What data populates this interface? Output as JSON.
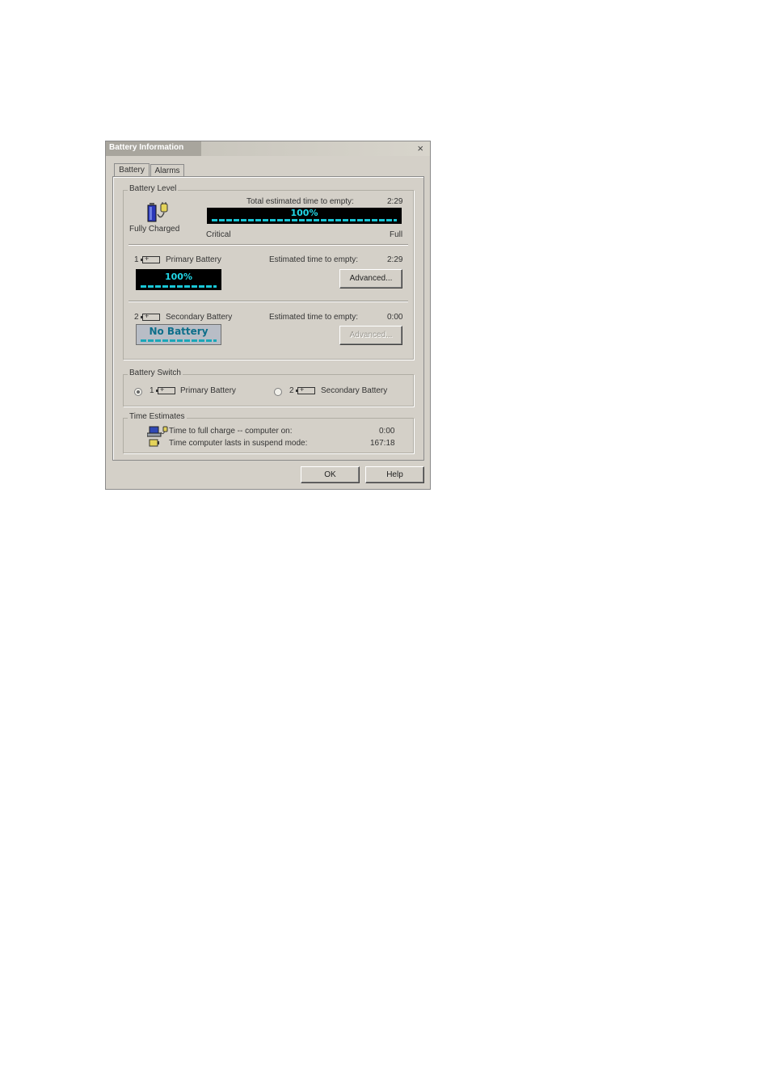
{
  "window": {
    "title": "Battery Information",
    "close": "×"
  },
  "tabs": [
    {
      "label": "Battery"
    },
    {
      "label": "Alarms"
    }
  ],
  "battery_level": {
    "legend": "Battery Level",
    "status": "Fully Charged",
    "total_label": "Total estimated time to empty:",
    "total_value": "2:29",
    "percent_text": "100%",
    "percent_value": 100,
    "min_label": "Critical",
    "max_label": "Full"
  },
  "primary": {
    "number": "1",
    "label": "Primary Battery",
    "time_label": "Estimated time to empty:",
    "time_value": "2:29",
    "percent_text": "100%",
    "percent_value": 100,
    "advanced_label": "Advanced..."
  },
  "secondary": {
    "number": "2",
    "label": "Secondary Battery",
    "time_label": "Estimated time to empty:",
    "time_value": "0:00",
    "status_text": "No Battery",
    "advanced_label": "Advanced..."
  },
  "switch": {
    "legend": "Battery Switch",
    "primary_number": "1",
    "primary_label": "Primary Battery",
    "secondary_number": "2",
    "secondary_label": "Secondary Battery",
    "selected": "primary"
  },
  "estimates": {
    "legend": "Time Estimates",
    "full_charge_label": "Time to full charge -- computer on:",
    "full_charge_value": "0:00",
    "suspend_label": "Time computer lasts in suspend mode:",
    "suspend_value": "167:18"
  },
  "buttons": {
    "ok": "OK",
    "help": "Help"
  },
  "colors": {
    "lcd_bg": "#000000",
    "lcd_text": "#22d8e8",
    "face": "#d4d0c8"
  }
}
